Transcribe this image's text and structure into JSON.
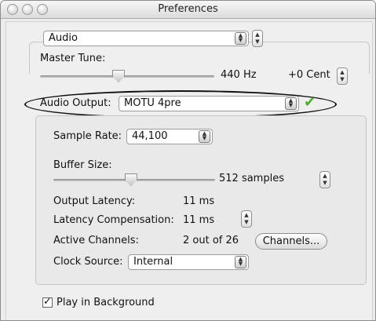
{
  "window": {
    "title": "Preferences"
  },
  "section_popup": {
    "value": "Audio"
  },
  "master_tune": {
    "label": "Master Tune:",
    "hz": "440 Hz",
    "cent": "+0 Cent",
    "level": 0.45
  },
  "audio_output": {
    "label": "Audio Output:",
    "value": "MOTU 4pre",
    "status_icon": "checkmark-icon",
    "status_color": "#4caf28"
  },
  "sample_rate": {
    "label": "Sample Rate:",
    "value": "44,100"
  },
  "buffer_size": {
    "label": "Buffer Size:",
    "value": "512 samples",
    "level": 0.48
  },
  "output_latency": {
    "label": "Output Latency:",
    "value": "11 ms"
  },
  "latency_compensation": {
    "label": "Latency Compensation:",
    "value": "11 ms"
  },
  "active_channels": {
    "label": "Active Channels:",
    "value": "2 out of 26",
    "button": "Channels..."
  },
  "clock_source": {
    "label": "Clock Source:",
    "value": "Internal"
  },
  "play_in_background": {
    "label": "Play in Background",
    "checked": true,
    "mark": "✓"
  }
}
